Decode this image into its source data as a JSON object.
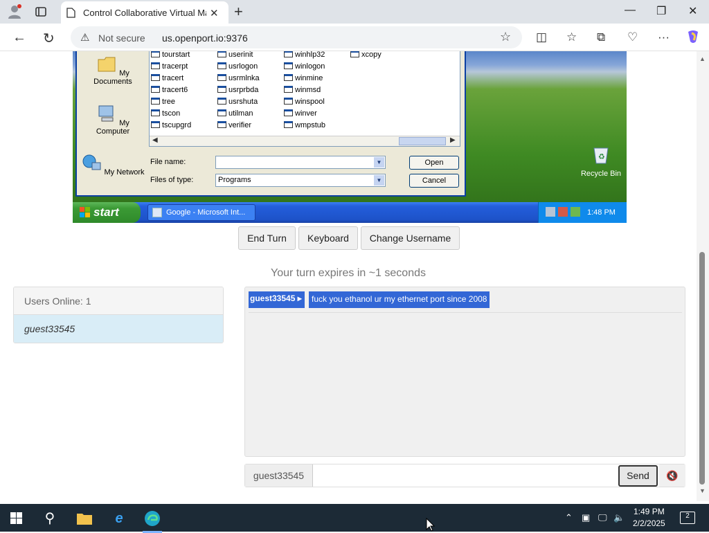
{
  "browser": {
    "tab_title": "Control Collaborative Virtual Mac",
    "security_label": "Not secure",
    "url": "us.openport.io:9376"
  },
  "vm": {
    "places": [
      "My Documents",
      "My Computer",
      "My Network"
    ],
    "files": [
      [
        "tourstart",
        "userinit",
        "winhlp32",
        "xcopy"
      ],
      [
        "tracerpt",
        "usrlogon",
        "winlogon"
      ],
      [
        "tracert",
        "usrmlnka",
        "winmine"
      ],
      [
        "tracert6",
        "usrprbda",
        "winmsd"
      ],
      [
        "tree",
        "usrshuta",
        "winspool"
      ],
      [
        "tscon",
        "utilman",
        "winver"
      ],
      [
        "tscupgrd",
        "verifier",
        "wmpstub"
      ]
    ],
    "file_name_label": "File name:",
    "file_name_value": "",
    "files_of_type_label": "Files of type:",
    "files_of_type_value": "Programs",
    "open_label": "Open",
    "cancel_label": "Cancel",
    "recycle_bin_label": "Recycle Bin",
    "start_label": "start",
    "task_label": "Google - Microsoft Int...",
    "tray_time": "1:48 PM"
  },
  "controls": {
    "end_turn": "End Turn",
    "keyboard": "Keyboard",
    "change_username": "Change Username",
    "turn_text": "Your turn expires in ~1 seconds"
  },
  "users": {
    "header": "Users Online: 1",
    "list": [
      "guest33545"
    ]
  },
  "chat": {
    "messages": [
      {
        "user": "guest33545 ▸",
        "text": "fuck you ethanol ur my ethernet port since 2008"
      }
    ],
    "username_addon": "guest33545",
    "input_value": "",
    "send_label": "Send"
  },
  "taskbar": {
    "time": "1:49 PM",
    "date": "2/2/2025",
    "notifications": "2"
  },
  "colors": {
    "xp_blue": "#245edb",
    "chat_highlight": "#3367d6",
    "user_row": "#d9edf7"
  }
}
